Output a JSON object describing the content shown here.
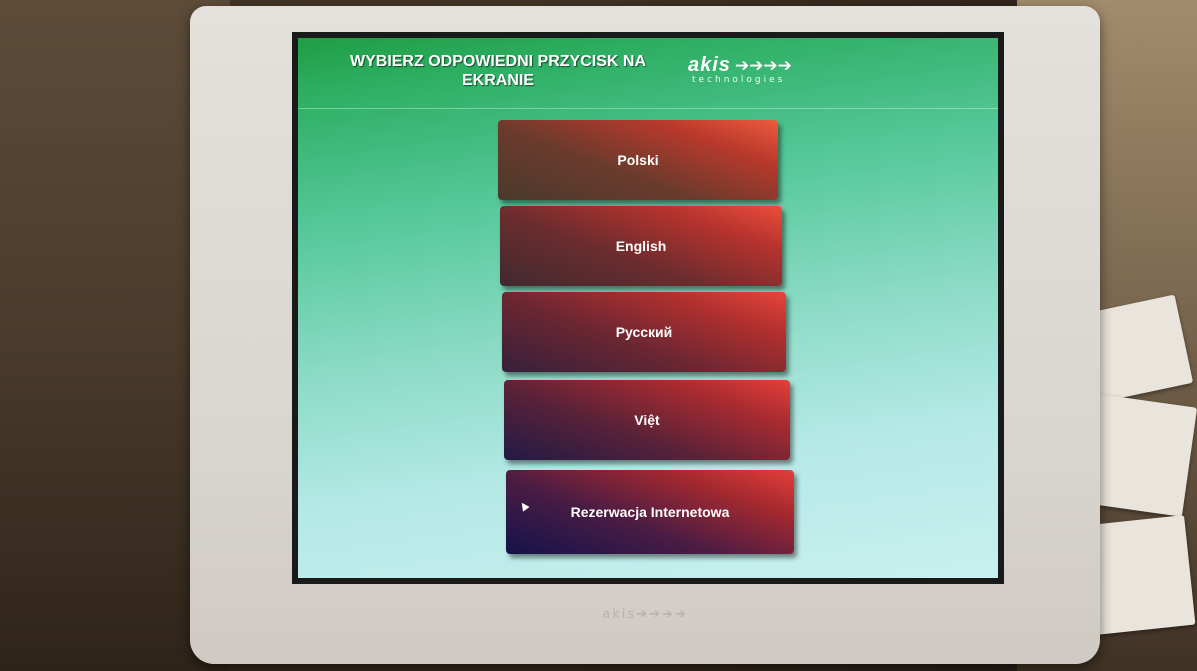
{
  "screen": {
    "title": "WYBIERZ ODPOWIEDNI PRZYCISK NA EKRANIE",
    "logo": {
      "word": "akis",
      "arrows": "➔➔➔➔",
      "subtitle": "technologies"
    }
  },
  "language_buttons": [
    {
      "label": "Polski"
    },
    {
      "label": "English"
    },
    {
      "label": "Русский"
    },
    {
      "label": "Việt"
    },
    {
      "label": "Rezerwacja Internetowa"
    }
  ],
  "bezel": {
    "brand": "akis➔➔➔➔"
  },
  "colors": {
    "screen_top": "#1f9e45",
    "screen_bottom": "#c8f0ee",
    "button_red": "#e8473a",
    "button_dark": "#1d1a3c"
  }
}
